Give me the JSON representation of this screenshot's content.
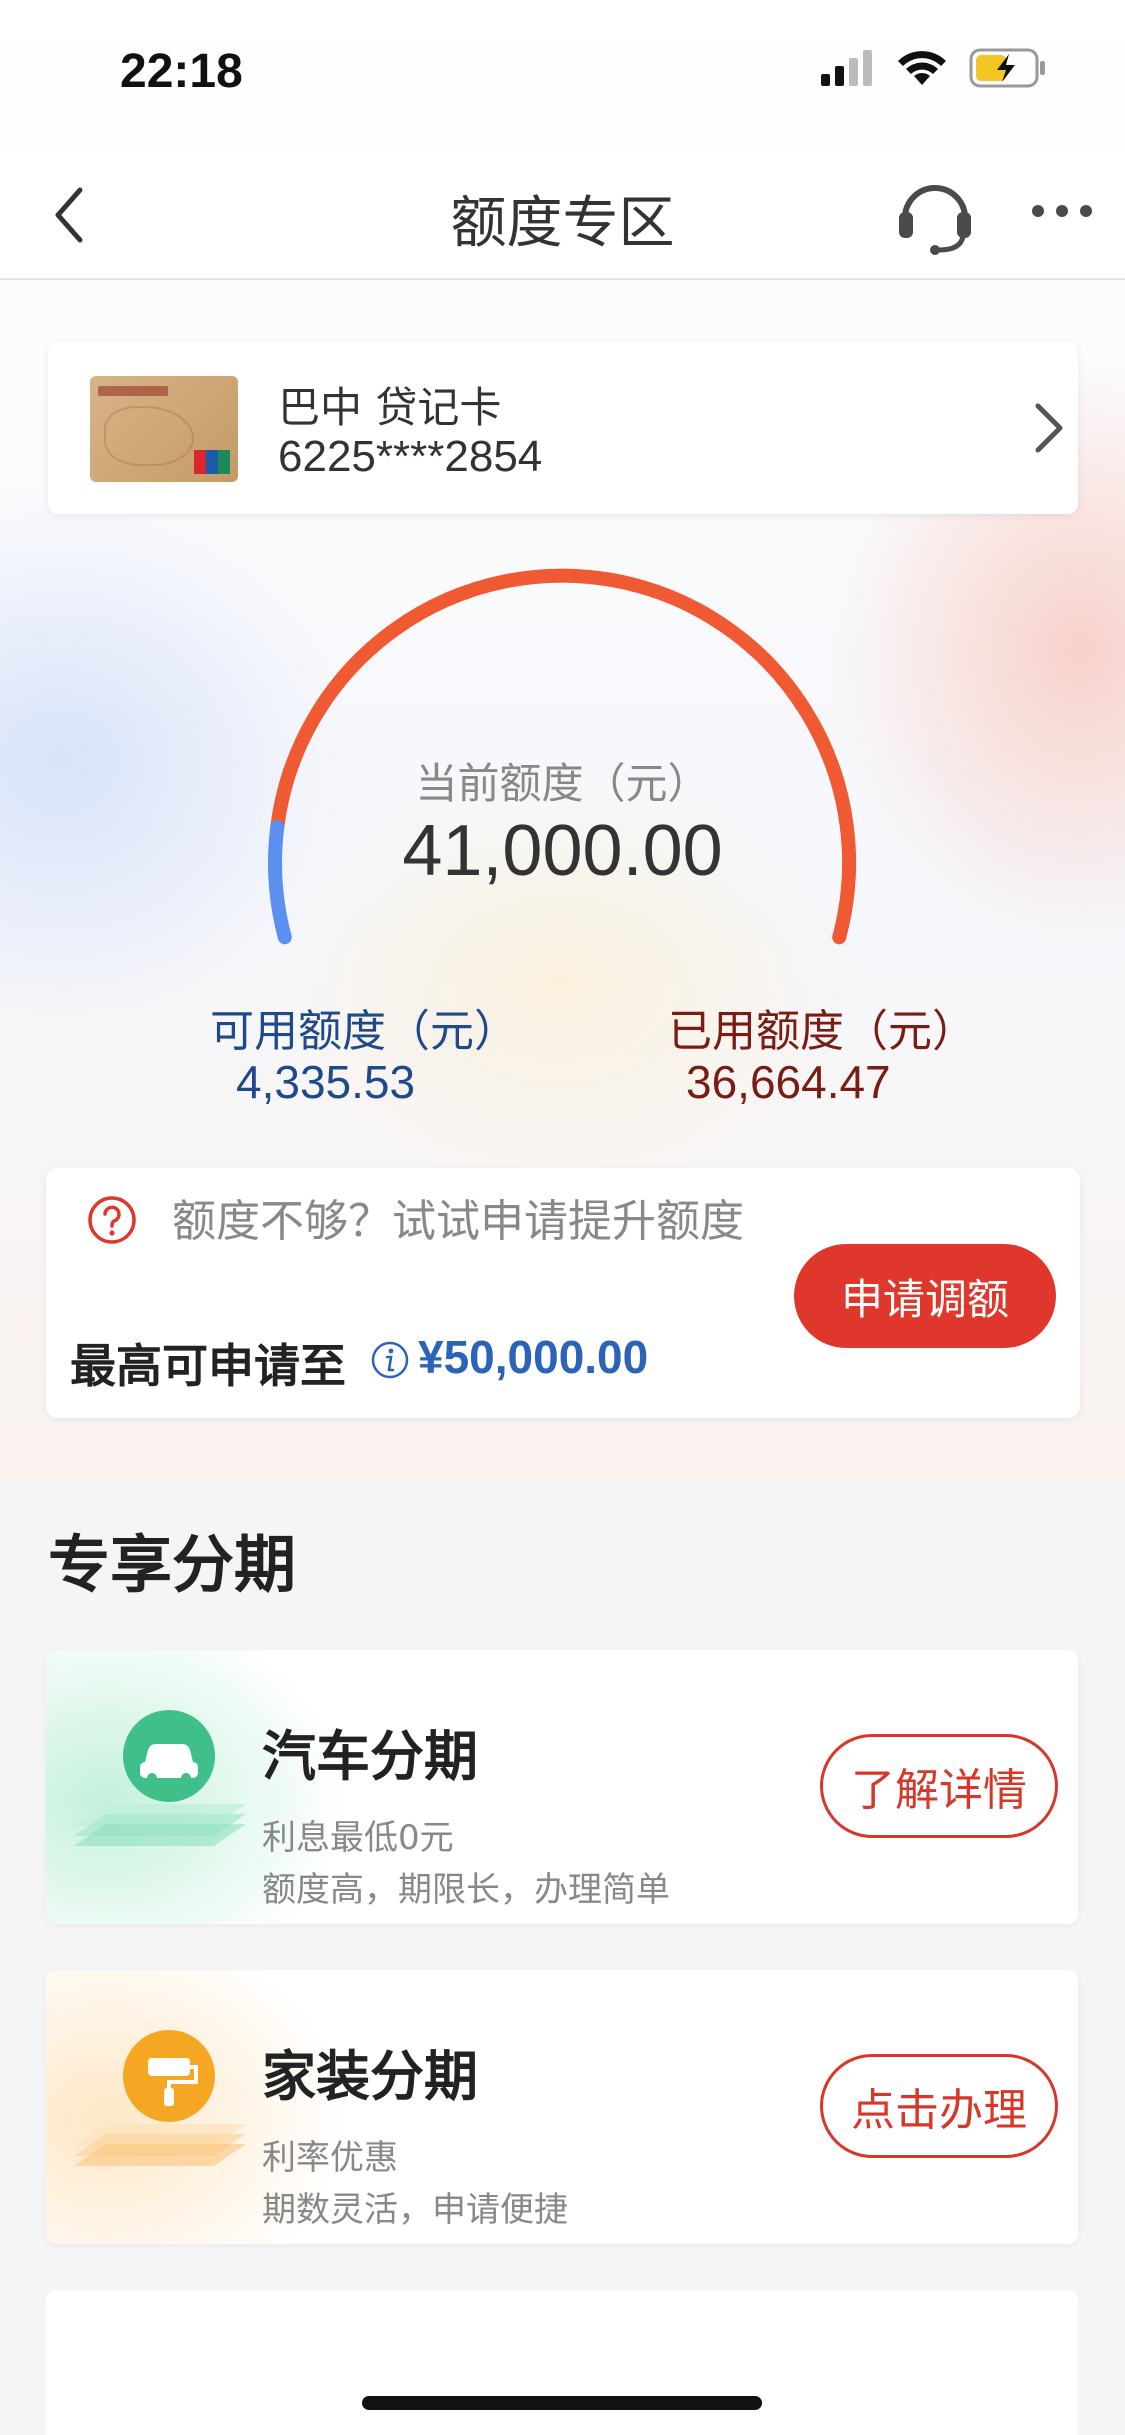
{
  "status_bar": {
    "time": "22:18"
  },
  "nav": {
    "title": "额度专区",
    "back_icon": "chevron-left-icon",
    "service_icon": "headset-icon",
    "more_icon": "more-dots-icon"
  },
  "card": {
    "name": "巴中 贷记卡",
    "number": "6225****2854"
  },
  "credit": {
    "current_label": "当前额度（元）",
    "current_value": "41,000.00",
    "available_label": "可用额度（元）",
    "available_value": "4,335.53",
    "used_label": "已用额度（元）",
    "used_value": "36,664.47",
    "available_fraction": 0.1057,
    "colors": {
      "available": "#5b8ff0",
      "used": "#ef5a32"
    }
  },
  "upgrade": {
    "prompt": "额度不够？试试申请提升额度",
    "max_label": "最高可申请至",
    "max_value": "¥50,000.00",
    "button_label": "申请调额"
  },
  "exclusive": {
    "title": "专享分期",
    "items": [
      {
        "title": "汽车分期",
        "line1": "利息最低0元",
        "line2": "额度高，期限长，办理简单",
        "button": "了解详情",
        "icon": "car-icon",
        "accent": "#3fbf8a"
      },
      {
        "title": "家装分期",
        "line1": "利率优惠",
        "line2": "期数灵活，申请便捷",
        "button": "点击办理",
        "icon": "paint-roller-icon",
        "accent": "#f5a623"
      }
    ]
  }
}
